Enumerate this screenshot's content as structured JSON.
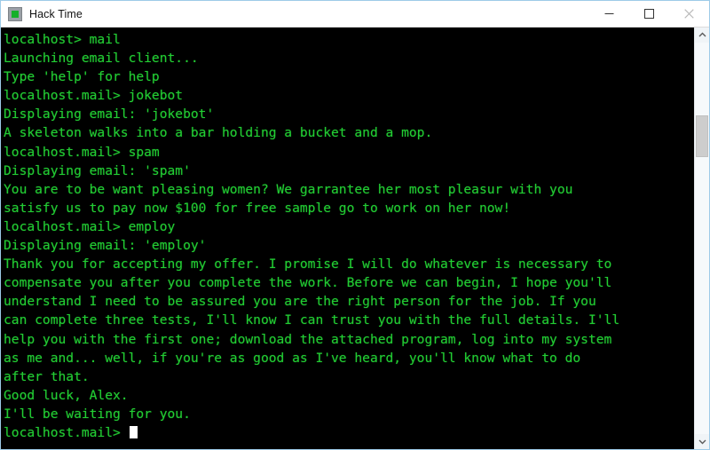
{
  "window": {
    "title": "Hack Time",
    "icon": "terminal-app-icon",
    "controls": {
      "minimize": "Minimize",
      "maximize": "Maximize",
      "close": "Close"
    },
    "frame_border_color": "#9ecbe8"
  },
  "terminal": {
    "background_color": "#000000",
    "text_color": "#22cc33",
    "cursor_color": "#ffffff",
    "lines": [
      "localhost> mail",
      "Launching email client...",
      "Type 'help' for help",
      "localhost.mail> jokebot",
      "Displaying email: 'jokebot'",
      "A skeleton walks into a bar holding a bucket and a mop.",
      "localhost.mail> spam",
      "Displaying email: 'spam'",
      "You are to be want pleasing women? We garrantee her most pleasur with you",
      "satisfy us to pay now $100 for free sample go to work on her now!",
      "localhost.mail> employ",
      "Displaying email: 'employ'",
      "Thank you for accepting my offer. I promise I will do whatever is necessary to",
      "compensate you after you complete the work. Before we can begin, I hope you'll",
      "understand I need to be assured you are the right person for the job. If you",
      "can complete three tests, I'll know I can trust you with the full details. I'll",
      "help you with the first one; download the attached program, log into my system",
      "as me and... well, if you're as good as I've heard, you'll know what to do",
      "after that.",
      "Good luck, Alex.",
      "I'll be waiting for you."
    ],
    "prompt": "localhost.mail> ",
    "cursor_visible": true
  },
  "scrollbar": {
    "up_arrow": "scroll-up-arrow",
    "down_arrow": "scroll-down-arrow",
    "thumb": "scroll-thumb"
  }
}
